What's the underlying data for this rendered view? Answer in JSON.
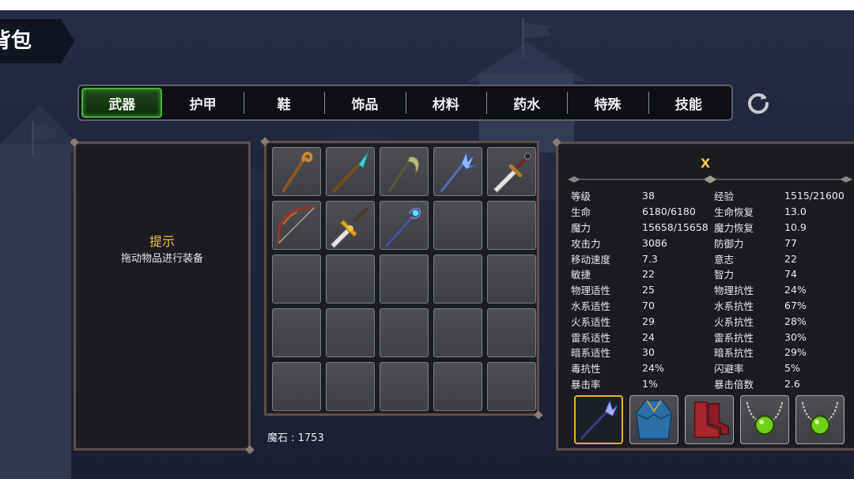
{
  "title": "背包",
  "tabs": [
    {
      "label": "武器",
      "active": true
    },
    {
      "label": "护甲",
      "active": false
    },
    {
      "label": "鞋",
      "active": false
    },
    {
      "label": "饰品",
      "active": false
    },
    {
      "label": "材料",
      "active": false
    },
    {
      "label": "药水",
      "active": false
    },
    {
      "label": "特殊",
      "active": false
    },
    {
      "label": "技能",
      "active": false
    }
  ],
  "hint": {
    "title": "提示",
    "text": "拖动物品进行装备"
  },
  "inventory": {
    "slots": [
      {
        "item": "crook-staff-icon"
      },
      {
        "item": "crystal-spear-icon"
      },
      {
        "item": "scythe-icon"
      },
      {
        "item": "ice-trident-icon"
      },
      {
        "item": "greatsword-icon"
      },
      {
        "item": "longbow-icon"
      },
      {
        "item": "golden-sword-icon"
      },
      {
        "item": "orb-staff-icon"
      },
      {
        "item": null
      },
      {
        "item": null
      },
      {
        "item": null
      },
      {
        "item": null
      },
      {
        "item": null
      },
      {
        "item": null
      },
      {
        "item": null
      },
      {
        "item": null
      },
      {
        "item": null
      },
      {
        "item": null
      },
      {
        "item": null
      },
      {
        "item": null
      },
      {
        "item": null
      },
      {
        "item": null
      },
      {
        "item": null
      },
      {
        "item": null
      },
      {
        "item": null
      }
    ],
    "currency_label": "魔石 : 1753"
  },
  "character": {
    "name": "X",
    "stats": [
      [
        "等级",
        "38",
        "经验",
        "1515/21600"
      ],
      [
        "生命",
        "6180/6180",
        "生命恢复",
        "13.0"
      ],
      [
        "魔力",
        "15658/15658",
        "魔力恢复",
        "10.9"
      ],
      [
        "攻击力",
        "3086",
        "防御力",
        "77"
      ],
      [
        "移动速度",
        "7.3",
        "意志",
        "22"
      ],
      [
        "敏捷",
        "22",
        "智力",
        "74"
      ],
      [
        "物理适性",
        "25",
        "物理抗性",
        "24%"
      ],
      [
        "水系适性",
        "70",
        "水系抗性",
        "67%"
      ],
      [
        "火系适性",
        "29",
        "火系抗性",
        "28%"
      ],
      [
        "雷系适性",
        "24",
        "雷系抗性",
        "30%"
      ],
      [
        "暗系适性",
        "30",
        "暗系抗性",
        "29%"
      ],
      [
        "毒抗性",
        "24%",
        "闪避率",
        "5%"
      ],
      [
        "暴击率",
        "1%",
        "暴击倍数",
        "2.6"
      ]
    ],
    "equipped": [
      {
        "item": "ice-spear-icon",
        "selected": true
      },
      {
        "item": "blue-robe-icon",
        "selected": false
      },
      {
        "item": "red-boots-icon",
        "selected": false
      },
      {
        "item": "green-gem-necklace-icon",
        "selected": false
      },
      {
        "item": "green-gem-necklace-icon",
        "selected": false
      }
    ]
  },
  "colors": {
    "active_tab_border": "#46b13a",
    "hint_title": "#e7c145",
    "character_name": "#f1c643",
    "selected_slot_border": "#e3b12b"
  }
}
